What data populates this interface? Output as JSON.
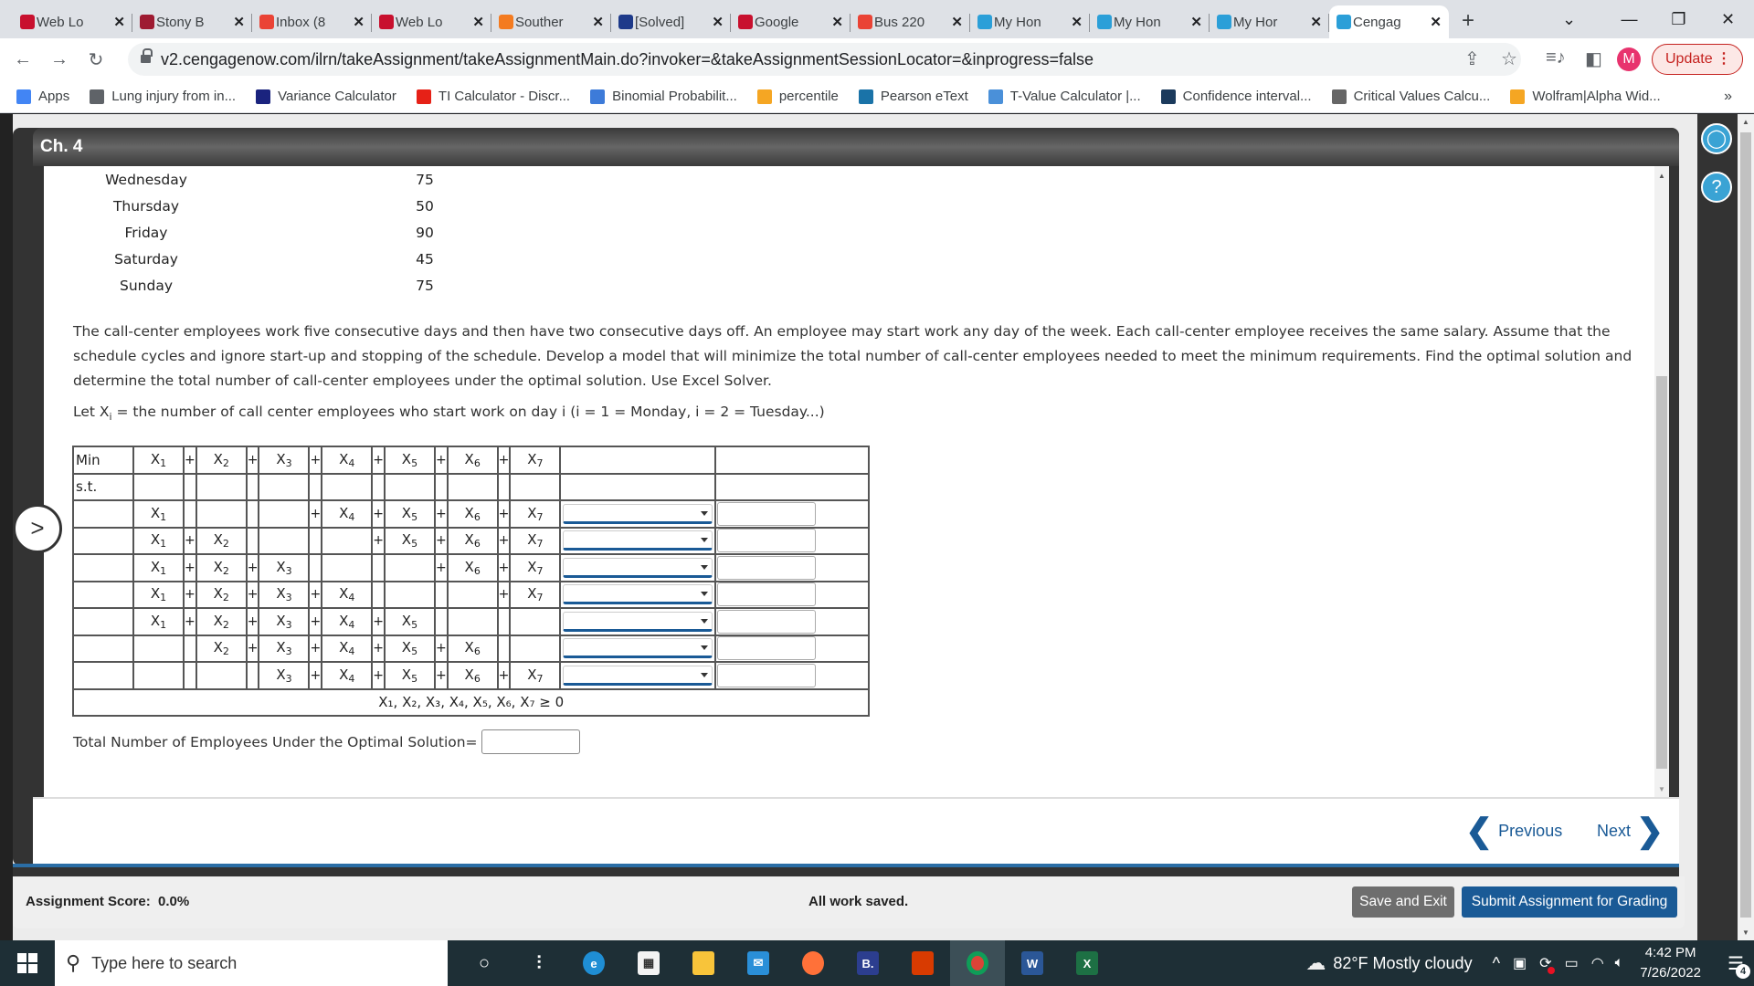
{
  "browser": {
    "tabs": [
      {
        "title": "Web Lo",
        "favicon": "shield-red"
      },
      {
        "title": "Stony B",
        "favicon": "shield-maroon"
      },
      {
        "title": "Inbox (8",
        "favicon": "gmail"
      },
      {
        "title": "Web Lo",
        "favicon": "shield-red"
      },
      {
        "title": "Souther",
        "favicon": "orange-c"
      },
      {
        "title": "[Solved]",
        "favicon": "star-shield"
      },
      {
        "title": "Google",
        "favicon": "shield-red"
      },
      {
        "title": "Bus 220",
        "favicon": "gmail"
      },
      {
        "title": "My Hon",
        "favicon": "cengage"
      },
      {
        "title": "My Hon",
        "favicon": "cengage"
      },
      {
        "title": "My Hor",
        "favicon": "cengage"
      },
      {
        "title": "Cengag",
        "favicon": "cengage",
        "active": true
      }
    ],
    "new_tab": "+",
    "url": "v2.cengagenow.com/ilrn/takeAssignment/takeAssignmentMain.do?invoker=&takeAssignmentSessionLocator=&inprogress=false",
    "profile_initial": "M",
    "update_label": "Update",
    "bookmarks": [
      {
        "label": "Apps",
        "color": "#4285f4"
      },
      {
        "label": "Lung injury from in...",
        "color": "#5f6368"
      },
      {
        "label": "Variance Calculator",
        "color": "#1a237e"
      },
      {
        "label": "TI Calculator - Discr...",
        "color": "#e62117"
      },
      {
        "label": "Binomial Probabilit...",
        "color": "#3d7bd9"
      },
      {
        "label": "percentile",
        "color": "#f5a623"
      },
      {
        "label": "Pearson eText",
        "color": "#1a73a8"
      },
      {
        "label": "T-Value Calculator |...",
        "color": "#4a90d9"
      },
      {
        "label": "Confidence interval...",
        "color": "#1b3a5c"
      },
      {
        "label": "Critical Values Calcu...",
        "color": "#666666"
      },
      {
        "label": "Wolfram|Alpha Wid...",
        "color": "#f5a623"
      }
    ],
    "more_bookmarks": "»"
  },
  "assignment": {
    "chapter_title": "Ch. 4",
    "requirements": [
      {
        "day": "Wednesday",
        "min": "75"
      },
      {
        "day": "Thursday",
        "min": "50"
      },
      {
        "day": "Friday",
        "min": "90"
      },
      {
        "day": "Saturday",
        "min": "45"
      },
      {
        "day": "Sunday",
        "min": "75"
      }
    ],
    "problem_text": "The call-center employees work five consecutive days and then have two consecutive days off. An employee may start work any day of the week. Each call-center employee receives the same salary. Assume that the schedule cycles and ignore start-up and stopping of the schedule. Develop a model that will minimize the total number of call-center employees needed to meet the minimum requirements. Find the optimal solution and determine the total number of call-center employees under the optimal solution. Use Excel Solver.",
    "let_text": "Let Xi = the number of call center employees who start work on day i (i = 1 = Monday, i = 2 = Tuesday...)",
    "model": {
      "min_label": "Min",
      "st_label": "s.t.",
      "objective": [
        "1",
        "2",
        "3",
        "4",
        "5",
        "6",
        "7"
      ],
      "constraints": [
        [
          "1",
          "",
          "",
          "4",
          "5",
          "6",
          "7"
        ],
        [
          "1",
          "2",
          "",
          "",
          "5",
          "6",
          "7"
        ],
        [
          "1",
          "2",
          "3",
          "",
          "",
          "6",
          "7"
        ],
        [
          "1",
          "2",
          "3",
          "4",
          "",
          "",
          "7"
        ],
        [
          "1",
          "2",
          "3",
          "4",
          "5",
          "",
          ""
        ],
        [
          "",
          "2",
          "3",
          "4",
          "5",
          "6",
          ""
        ],
        [
          "",
          "",
          "3",
          "4",
          "5",
          "6",
          "7"
        ]
      ],
      "constraint_selects": [
        "",
        "",
        "",
        "",
        "",
        "",
        ""
      ],
      "constraint_rhs": [
        "",
        "",
        "",
        "",
        "",
        "",
        ""
      ],
      "nonneg": "X₁, X₂, X₃, X₄, X₅, X₆, X₇ ≥ 0"
    },
    "total_label": "Total Number of Employees Under the Optimal Solution=",
    "total_value": "",
    "previous_label": "Previous",
    "next_label": "Next",
    "score_label": "Assignment Score:",
    "score_value": "0.0%",
    "save_status": "All work saved.",
    "save_exit_label": "Save and Exit",
    "submit_label": "Submit Assignment for Grading"
  },
  "taskbar": {
    "search_placeholder": "Type here to search",
    "weather": "82°F  Mostly cloudy",
    "time": "4:42 PM",
    "date": "7/26/2022",
    "notifications": "4"
  }
}
